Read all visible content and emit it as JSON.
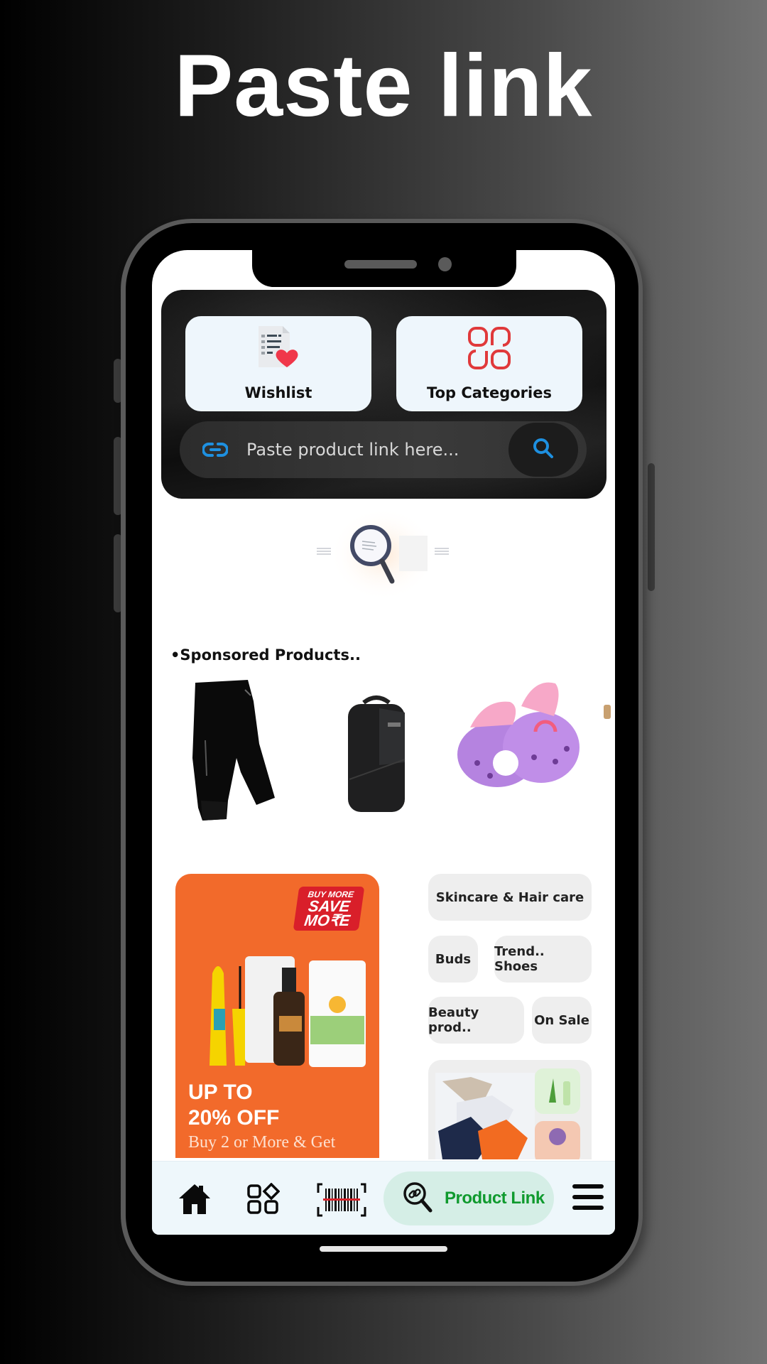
{
  "headline": "Paste link",
  "hero": {
    "cards": [
      {
        "label": "Wishlist",
        "icon": "wishlist-icon"
      },
      {
        "label": "Top Categories",
        "icon": "categories-icon"
      }
    ],
    "search": {
      "placeholder": "Paste product link here...",
      "value": "",
      "leading_icon": "link-icon",
      "button_icon": "search-icon",
      "accent": "#1e90e0"
    }
  },
  "sponsored": {
    "title": "•Sponsored Products..",
    "products": [
      {
        "name": "Black shorts"
      },
      {
        "name": "Black backpack"
      },
      {
        "name": "Purple clogs"
      }
    ]
  },
  "promo": {
    "badge_line1": "BUY MORE",
    "badge_line2": "SAVE",
    "badge_line3": "MO₹E",
    "headline_line1": "UP TO",
    "headline_line2": "20% OFF",
    "subtext": "Buy 2 or More & Get",
    "background": "#f26a2b"
  },
  "chips": [
    {
      "label": "Skincare & Hair care"
    },
    {
      "label": "Buds"
    },
    {
      "label": "Trend.. Shoes"
    },
    {
      "label": "Beauty prod.."
    },
    {
      "label": "On Sale"
    }
  ],
  "bottom_nav": {
    "items": [
      {
        "icon": "home-icon"
      },
      {
        "icon": "apps-grid-icon"
      },
      {
        "icon": "barcode-scan-icon"
      },
      {
        "icon": "link-search-icon",
        "label": "Product Link",
        "active": true
      },
      {
        "icon": "menu-icon"
      }
    ],
    "active_color": "#0f9a2e"
  }
}
